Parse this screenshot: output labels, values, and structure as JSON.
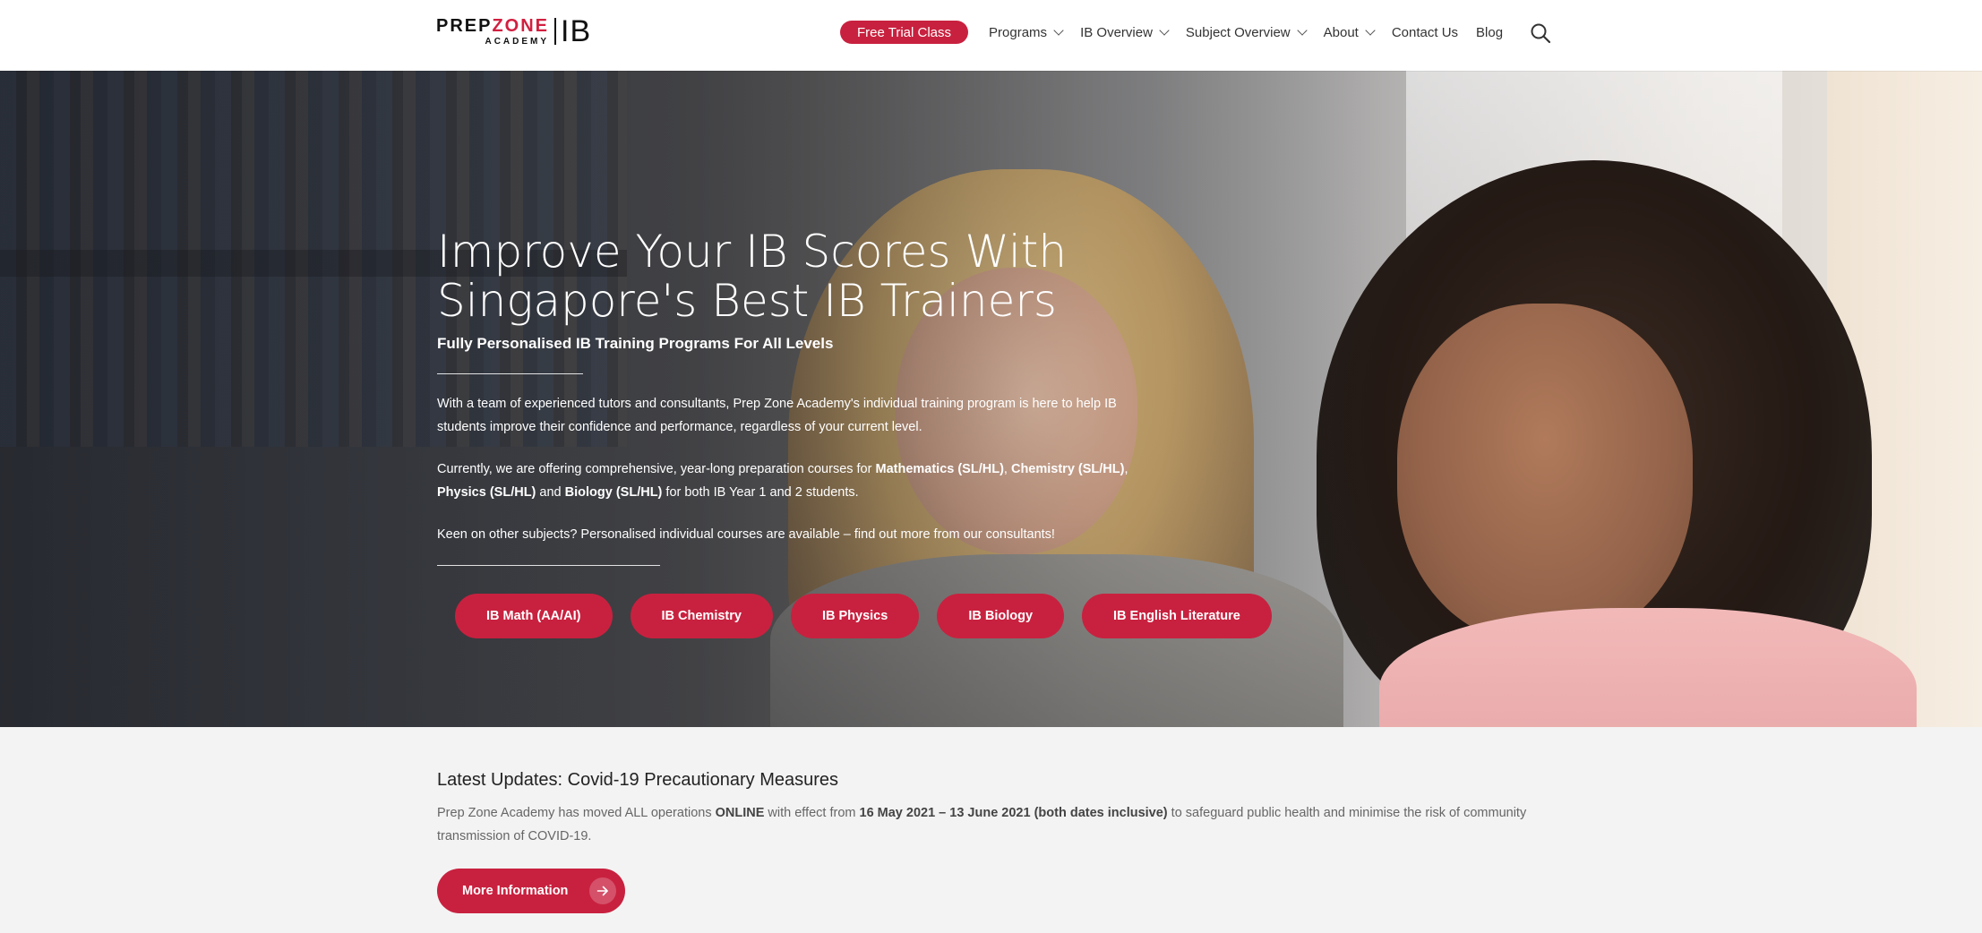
{
  "header": {
    "logo": {
      "word_prep": "PREP",
      "word_zone": "ZONE",
      "word_academy": "ACADEMY",
      "word_ib": "IB"
    },
    "trial_button": "Free Trial Class",
    "nav": [
      {
        "label": "Programs",
        "has_dropdown": true
      },
      {
        "label": "IB Overview",
        "has_dropdown": true
      },
      {
        "label": "Subject Overview",
        "has_dropdown": true
      },
      {
        "label": "About",
        "has_dropdown": true
      },
      {
        "label": "Contact Us",
        "has_dropdown": false
      },
      {
        "label": "Blog",
        "has_dropdown": false
      }
    ],
    "search_icon": "search-icon"
  },
  "hero": {
    "title_line1": "Improve Your IB Scores With",
    "title_line2": "Singapore's Best IB Trainers",
    "subtitle": "Fully Personalised IB Training Programs For All Levels",
    "para1": "With a team of experienced tutors and consultants, Prep Zone Academy's individual training program is here to help IB students improve their confidence and performance, regardless of your current level.",
    "para2": {
      "prefix": "Currently, we are offering comprehensive, year-long preparation courses for ",
      "math": "Mathematics (SL/HL)",
      "sep1": ", ",
      "chem": "Chemistry (SL/HL)",
      "sep2": ", ",
      "phys": "Physics (SL/HL)",
      "and": " and ",
      "bio": "Biology (SL/HL)",
      "suffix": " for both IB Year 1 and 2 students."
    },
    "para3": "Keen on other subjects? Personalised individual courses are available – find out more from our consultants!",
    "subjects": [
      "IB Math (AA/AI)",
      "IB Chemistry",
      "IB Physics",
      "IB Biology",
      "IB English Literature"
    ]
  },
  "updates": {
    "title": "Latest Updates: Covid-19 Precautionary Measures",
    "text": {
      "part1": "Prep Zone Academy has moved ALL operations ",
      "bold1": "ONLINE",
      "part2": " with effect from ",
      "bold2": "16 May 2021 – 13 June 2021 (both dates inclusive)",
      "part3": " to safeguard public health and minimise the risk of community transmission of COVID-19."
    },
    "button": "More Information",
    "button_icon": "arrow-right-icon"
  },
  "colors": {
    "accent": "#c8213f",
    "header_bg": "#ffffff",
    "section_bg": "#f3f3f3"
  }
}
